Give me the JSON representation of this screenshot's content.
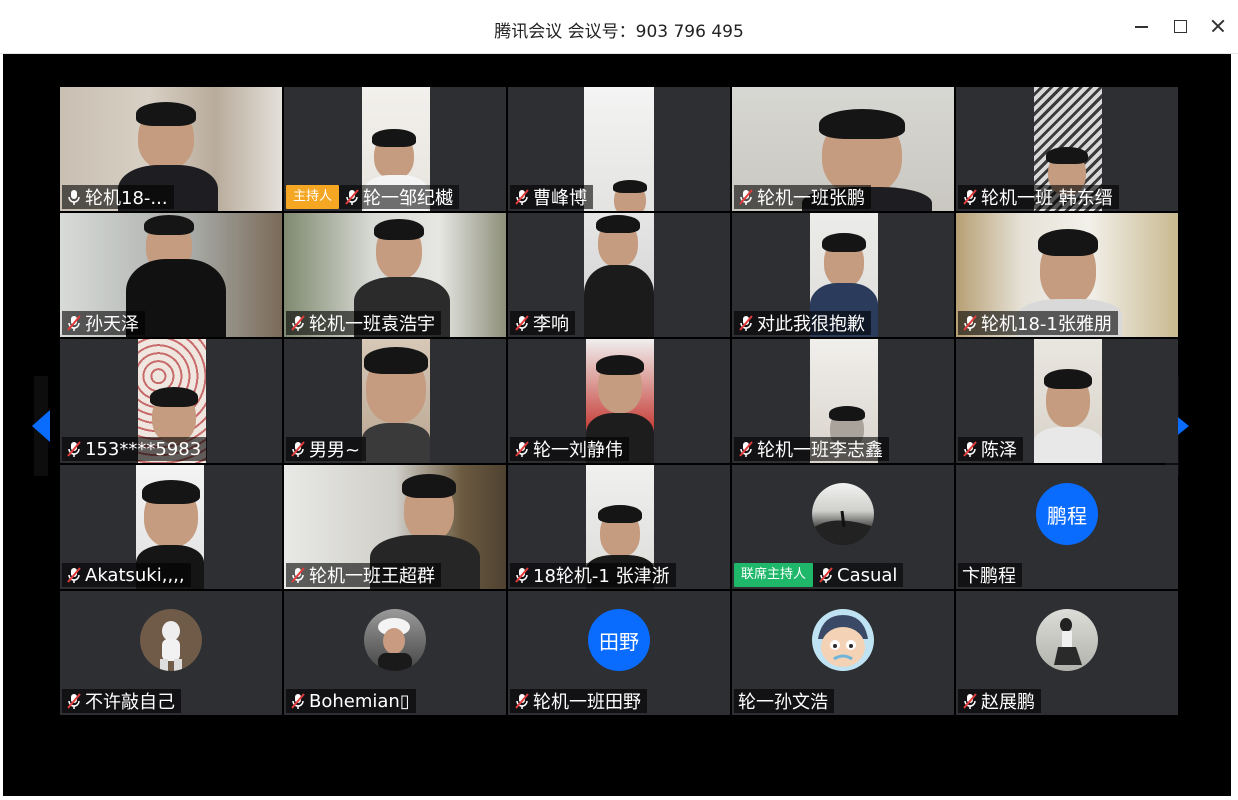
{
  "window": {
    "title": "腾讯会议 会议号：903 796 495",
    "minimize_icon": "minimize-icon",
    "maximize_icon": "maximize-icon",
    "close_icon": "close-icon"
  },
  "colors": {
    "stage_bg": "#000000",
    "tile_bg": "#2d2f33",
    "host_badge": "#f5a623",
    "cohost_badge": "#1fb86a",
    "avatar_blue": "#0a6cff",
    "nav_arrow": "#0a6cff"
  },
  "badges": {
    "host": "主持人",
    "cohost": "联席主持人"
  },
  "participants": [
    {
      "name": "轮机18-...",
      "mic": "on"
    },
    {
      "name": "轮一邹纪樾",
      "mic": "muted",
      "badge": "host"
    },
    {
      "name": "曹峰博",
      "mic": "muted"
    },
    {
      "name": "轮机一班张鹏",
      "mic": "muted"
    },
    {
      "name": "轮机一班 韩东缙",
      "mic": "muted"
    },
    {
      "name": "孙天泽",
      "mic": "muted"
    },
    {
      "name": "轮机一班袁浩宇",
      "mic": "muted"
    },
    {
      "name": "李响",
      "mic": "muted"
    },
    {
      "name": "对此我很抱歉",
      "mic": "muted"
    },
    {
      "name": "轮机18-1张雅朋",
      "mic": "muted"
    },
    {
      "name": "153****5983",
      "mic": "muted"
    },
    {
      "name": "男男~",
      "mic": "muted"
    },
    {
      "name": "轮一刘静伟",
      "mic": "muted"
    },
    {
      "name": "轮机一班李志鑫",
      "mic": "muted"
    },
    {
      "name": "陈泽",
      "mic": "muted"
    },
    {
      "name": "Akatsuki,,,,",
      "mic": "muted"
    },
    {
      "name": "轮机一班王超群",
      "mic": "muted"
    },
    {
      "name": " 18轮机-1 张津浙",
      "mic": "muted"
    },
    {
      "name": "Casual",
      "mic": "muted",
      "badge": "cohost"
    },
    {
      "name": "卞鹏程",
      "mic": "none",
      "avatar_text": "鹏程"
    },
    {
      "name": "不许敲自己",
      "mic": "muted"
    },
    {
      "name": "Bohemian▯",
      "mic": "muted"
    },
    {
      "name": "轮机一班田野",
      "mic": "muted",
      "avatar_text": "田野"
    },
    {
      "name": "轮一孙文浩",
      "mic": "none"
    },
    {
      "name": "赵展鹏",
      "mic": "muted"
    }
  ]
}
